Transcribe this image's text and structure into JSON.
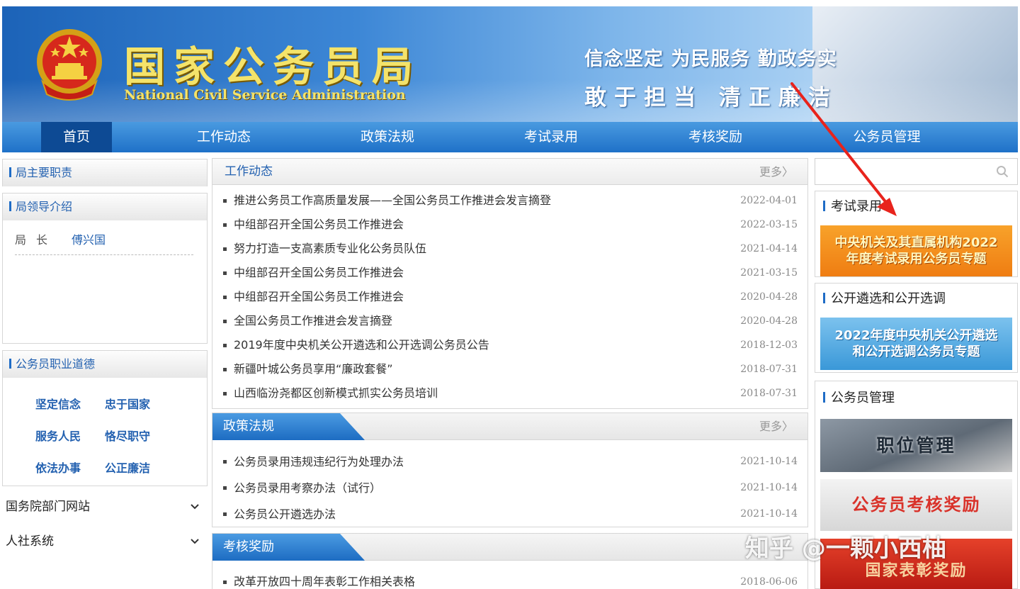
{
  "header": {
    "title": "国家公务员局",
    "subtitle": "National Civil Service Administration",
    "slogan_line1": "信念坚定 为民服务 勤政务实",
    "slogan_line2": "敢于担当 清正廉洁"
  },
  "nav": {
    "items": [
      {
        "label": "首页",
        "active": true
      },
      {
        "label": "工作动态"
      },
      {
        "label": "政策法规"
      },
      {
        "label": "考试录用"
      },
      {
        "label": "考核奖励"
      },
      {
        "label": "公务员管理"
      }
    ]
  },
  "left": {
    "duties_title": "局主要职责",
    "leaders_title": "局领导介绍",
    "leader": {
      "role": "局长",
      "name": "傅兴国"
    },
    "ethics_title": "公务员职业道德",
    "ethics": [
      "坚定信念",
      "忠于国家",
      "服务人民",
      "恪尽职守",
      "依法办事",
      "公正廉洁"
    ],
    "links": [
      "国务院部门网站",
      "人社系统"
    ]
  },
  "work_news": {
    "title": "工作动态",
    "more": "更多〉",
    "items": [
      {
        "title": "推进公务员工作高质量发展——全国公务员工作推进会发言摘登",
        "date": "2022-04-01"
      },
      {
        "title": "中组部召开全国公务员工作推进会",
        "date": "2022-03-15"
      },
      {
        "title": "努力打造一支高素质专业化公务员队伍",
        "date": "2021-04-14"
      },
      {
        "title": "中组部召开全国公务员工作推进会",
        "date": "2021-03-15"
      },
      {
        "title": "中组部召开全国公务员工作推进会",
        "date": "2020-04-28"
      },
      {
        "title": "全国公务员工作推进会发言摘登",
        "date": "2020-04-28"
      },
      {
        "title": "2019年度中央机关公开遴选和公开选调公务员公告",
        "date": "2018-12-03"
      },
      {
        "title": "新疆叶城公务员享用“廉政套餐”",
        "date": "2018-07-31"
      },
      {
        "title": "山西临汾尧都区创新模式抓实公务员培训",
        "date": "2018-07-31"
      }
    ]
  },
  "policy": {
    "title": "政策法规",
    "more": "更多〉",
    "items": [
      {
        "title": "公务员录用违规违纪行为处理办法",
        "date": "2021-10-14"
      },
      {
        "title": "公务员录用考察办法（试行）",
        "date": "2021-10-14"
      },
      {
        "title": "公务员公开遴选办法",
        "date": "2021-10-14"
      }
    ]
  },
  "assessment": {
    "title": "考核奖励",
    "items": [
      {
        "title": "改革开放四十周年表彰工作相关表格",
        "date": "2018-06-06"
      }
    ]
  },
  "right": {
    "search_placeholder": "",
    "exam": {
      "title": "考试录用",
      "banner_line1": "中央机关及其直属机构2022",
      "banner_line2": "年度考试录用公务员专题"
    },
    "selection": {
      "title": "公开遴选和公开选调",
      "banner_line1": "2022年度中央机关公开遴选",
      "banner_line2": "和公开选调公务员专题"
    },
    "management": {
      "title": "公务员管理",
      "banner1": "职位管理",
      "banner2": "公务员考核奖励",
      "banner3": "国家表彰奖励"
    }
  },
  "watermark": "知乎 @一颗小西柚",
  "colors": {
    "brand_blue": "#1f6cc6",
    "nav_active": "#0d4a94",
    "title_gold": "#f4e36a",
    "arrow_red": "#e8231c"
  }
}
